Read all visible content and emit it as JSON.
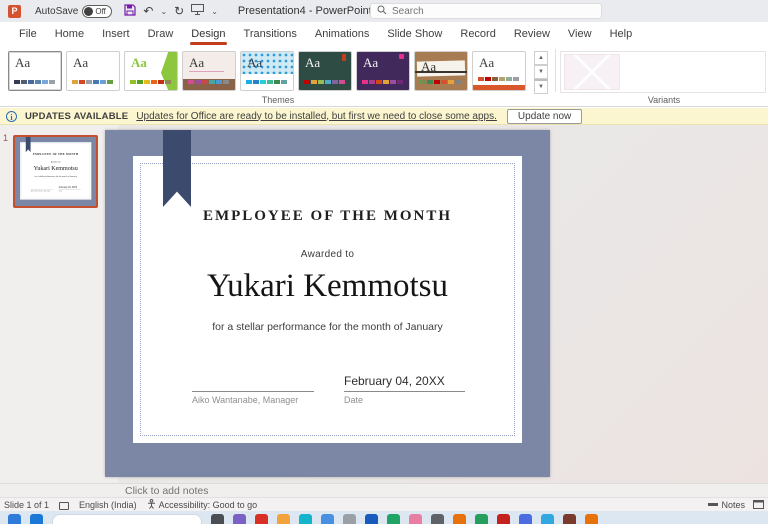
{
  "titlebar": {
    "autosave_label": "AutoSave",
    "autosave_state": "Off",
    "title": "Presentation4 - PowerPoint",
    "search_placeholder": "Search",
    "undo_icon": "↶",
    "redo_icon": "↻",
    "present_icon": "⊻",
    "customize_icon": "⌄"
  },
  "menubar": {
    "items": [
      "File",
      "Home",
      "Insert",
      "Draw",
      "Design",
      "Transitions",
      "Animations",
      "Slide Show",
      "Record",
      "Review",
      "View",
      "Help"
    ],
    "active": "Design"
  },
  "ribbon": {
    "themes_label": "Themes",
    "variants_label": "Variants",
    "scroll_up": "▲",
    "scroll_down": "▼",
    "scroll_more": "▼",
    "themes": [
      {
        "name": "office-selected",
        "aa": "Aa",
        "bg": "#ffffff",
        "fg": "#404040",
        "swatches": [
          "#333d4f",
          "#515c70",
          "#44699d",
          "#5b84b1",
          "#7da7d9",
          "#9aa2ab"
        ]
      },
      {
        "name": "theme-2",
        "aa": "Aa",
        "bg": "#ffffff",
        "fg": "#404040",
        "swatches": [
          "#e2a33d",
          "#d24726",
          "#9aa0a6",
          "#4a78b5",
          "#6aa2d8",
          "#67a040"
        ]
      },
      {
        "name": "facet",
        "aa": "Aa",
        "bg": "#ffffff",
        "fg": "#8dc63f",
        "swatches": [
          "#90c226",
          "#54a021",
          "#e6b91e",
          "#e76618",
          "#c42f1a",
          "#918655"
        ]
      },
      {
        "name": "theme-4",
        "aa": "Aa",
        "bg": "#f3ece8",
        "fg": "#3b3b3b",
        "swatches": [
          "#d34d96",
          "#9e4ea0",
          "#c64847",
          "#4aa5a2",
          "#4a9bd1",
          "#8a8a8a"
        ]
      },
      {
        "name": "integral",
        "aa": "Aa",
        "bg": "#ffffff",
        "fg": "#2e3a46",
        "swatches": [
          "#1cade4",
          "#2683c6",
          "#27ced7",
          "#42ba97",
          "#3e8853",
          "#62a39f"
        ]
      },
      {
        "name": "chalkboard",
        "aa": "Aa",
        "bg": "#2e4b44",
        "fg": "#f2f2f2",
        "swatches": [
          "#c00000",
          "#e2a33d",
          "#9bbb59",
          "#4bacc6",
          "#8064a2",
          "#d34d96"
        ]
      },
      {
        "name": "theme-7",
        "aa": "Aa",
        "bg": "#41295b",
        "fg": "#f2f2f2",
        "swatches": [
          "#e8308a",
          "#ab3d8f",
          "#d34817",
          "#e2a33d",
          "#9e4ea0",
          "#742774"
        ]
      },
      {
        "name": "wood",
        "aa": "Aa",
        "bg": "#a87c52",
        "fg": "#3a342e",
        "swatches": [
          "#6f9154",
          "#3e8853",
          "#c00000",
          "#d4502f",
          "#e2a33d",
          "#818183"
        ]
      },
      {
        "name": "theme-9",
        "aa": "Aa",
        "bg": "#ffffff",
        "fg": "#404040",
        "swatches": [
          "#d4502f",
          "#c00000",
          "#8a5d3b",
          "#b5a36a",
          "#8fae9a",
          "#9aa0a6"
        ]
      }
    ]
  },
  "notification": {
    "info_icon": "i",
    "badge": "UPDATES AVAILABLE",
    "message": "Updates for Office are ready to be installed, but first we need to close some apps.",
    "button": "Update now"
  },
  "slide_panel": {
    "slide_number": "1"
  },
  "slide": {
    "title": "EMPLOYEE OF THE MONTH",
    "awarded_label": "Awarded to",
    "name": "Yukari Kemmotsu",
    "subtitle": "for a stellar performance for the month of January",
    "signature_name": "Aiko Wantanabe, Manager",
    "date_value": "February 04, 20XX",
    "date_label": "Date"
  },
  "notes_panel": {
    "placeholder": "Click to add notes"
  },
  "statusbar": {
    "slide_indicator": "Slide 1 of 1",
    "language": "English (India)",
    "accessibility": "Accessibility: Good to go",
    "accessibility_icon": "☇",
    "notes_label": "Notes"
  },
  "taskbar": {
    "icons": [
      "#2f7bd9",
      "#1b78d7",
      "SEARCH",
      "#4b4f54",
      "#7b61c4",
      "#d93025",
      "#f2a33c",
      "#12b5cb",
      "#4a90e2",
      "#9aa0a6",
      "#185abd",
      "#21a366",
      "#e87ea1",
      "#5f6368",
      "#e8710a",
      "#25a05c",
      "#c5221f",
      "#4a6ee0",
      "#31a8e0",
      "#7a3b2e",
      "#e8710a"
    ]
  },
  "colors": {
    "accent_red": "#c43e1c",
    "slide_bg": "#7b87a5",
    "bookmark": "#3c4a6d",
    "selection_border": "#c4502e",
    "notification_bg": "#fbf5d0"
  }
}
